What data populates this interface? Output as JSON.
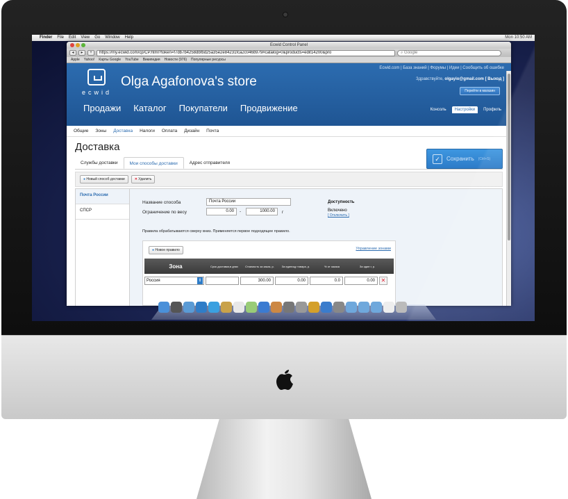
{
  "menubar": {
    "app": "Finder",
    "items": [
      "File",
      "Edit",
      "View",
      "Go",
      "Window",
      "Help"
    ],
    "clock": "Mon 10:50 AM"
  },
  "browser": {
    "window_title": "Ecwid Control Panel",
    "url": "https://my.ecwid.com/cp/CP.html?token=f7db7b4258dbfbd25a35e2e84231fca2c046b979#catalog=0&products=edit14200&pro",
    "search_placeholder": "Google",
    "bookmarks": [
      "Apple",
      "Yahoo!",
      "Карты Google",
      "YouTube",
      "Википедия",
      "Новости (976)",
      "Популярные ресурсы"
    ]
  },
  "header": {
    "logo_text": "ecwid",
    "store_name": "Olga Agafonova's store",
    "top_links": "Ecwid.com  |  База знаний  |  Форумы  |  Идеи  |  Сообщить об ошибке",
    "greeting": "Здравствуйте,",
    "user_email": "olgayio@gmail.com",
    "logout": "[ Выход ]",
    "goto_store": "Перейти в магазин",
    "main_nav": [
      "Продажи",
      "Каталог",
      "Покупатели",
      "Продвижение"
    ],
    "right_nav": [
      "Консоль",
      "Настройки",
      "Профиль"
    ],
    "right_nav_active": "Настройки"
  },
  "subnav": {
    "items": [
      "Общие",
      "Зоны",
      "Доставка",
      "Налоги",
      "Оплата",
      "Дизайн",
      "Почта"
    ],
    "active": "Доставка"
  },
  "page": {
    "title": "Доставка",
    "save_label": "Сохранить",
    "save_shortcut": "(Ctrl+S)",
    "tabs": [
      "Службы доставки",
      "Мои способы доставки",
      "Адрес отправителя"
    ],
    "active_tab": "Мои способы доставки",
    "new_method": "Новый способ доставки",
    "delete": "Удалить"
  },
  "methods": [
    "Почта России",
    "СПСР"
  ],
  "active_method": "Почта России",
  "detail": {
    "name_label": "Название способа",
    "name_value": "Почта России",
    "weight_label": "Ограничение по весу",
    "weight_from": "0.00",
    "weight_to": "1000.00",
    "weight_unit": "г",
    "availability_title": "Доступность",
    "availability_status": "Включено",
    "availability_action": "[ Отключить ]",
    "rules_note": "Правила обрабатываются сверху вниз. Применяется первое подходящее правило.",
    "new_rule": "Новое правило",
    "manage_zones": "Управление зонами"
  },
  "rules_table": {
    "headers": [
      "Зона",
      "Срок доставки,в днях",
      "Стоимость за заказ, р.",
      "За единицу товара, р.",
      "% от заказа",
      "За один г, р."
    ],
    "rows": [
      {
        "zone": "Россия",
        "delivery_days": "",
        "per_order": "300.00",
        "per_item": "0.00",
        "percent": "0.0",
        "per_gram": "0.00"
      }
    ]
  },
  "colors": {
    "header_blue": "#2c6cb0",
    "save_button": "#3e97e0",
    "table_header": "#4a4a4a"
  }
}
